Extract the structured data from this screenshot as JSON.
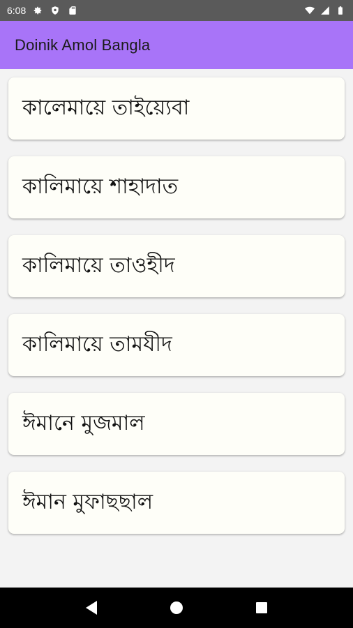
{
  "status_bar": {
    "time": "6:08",
    "left_icons": [
      "gear-icon",
      "shield-icon",
      "sd-card-icon"
    ],
    "right_icons": [
      "wifi-icon",
      "signal-icon",
      "battery-icon"
    ]
  },
  "app_bar": {
    "title": "Doinik Amol Bangla",
    "background": "#a874f8"
  },
  "list": {
    "items": [
      {
        "label": "কালেমায়ে তাইয়্যেবা"
      },
      {
        "label": "কালিমায়ে শাহাদাত"
      },
      {
        "label": "কালিমায়ে তাওহীদ"
      },
      {
        "label": "কালিমায়ে তামযীদ"
      },
      {
        "label": "ঈমানে মুজমাল"
      },
      {
        "label": "ঈমান মুফাছছাল"
      }
    ]
  },
  "nav_bar": {
    "buttons": [
      "back-icon",
      "home-icon",
      "recents-icon"
    ]
  }
}
